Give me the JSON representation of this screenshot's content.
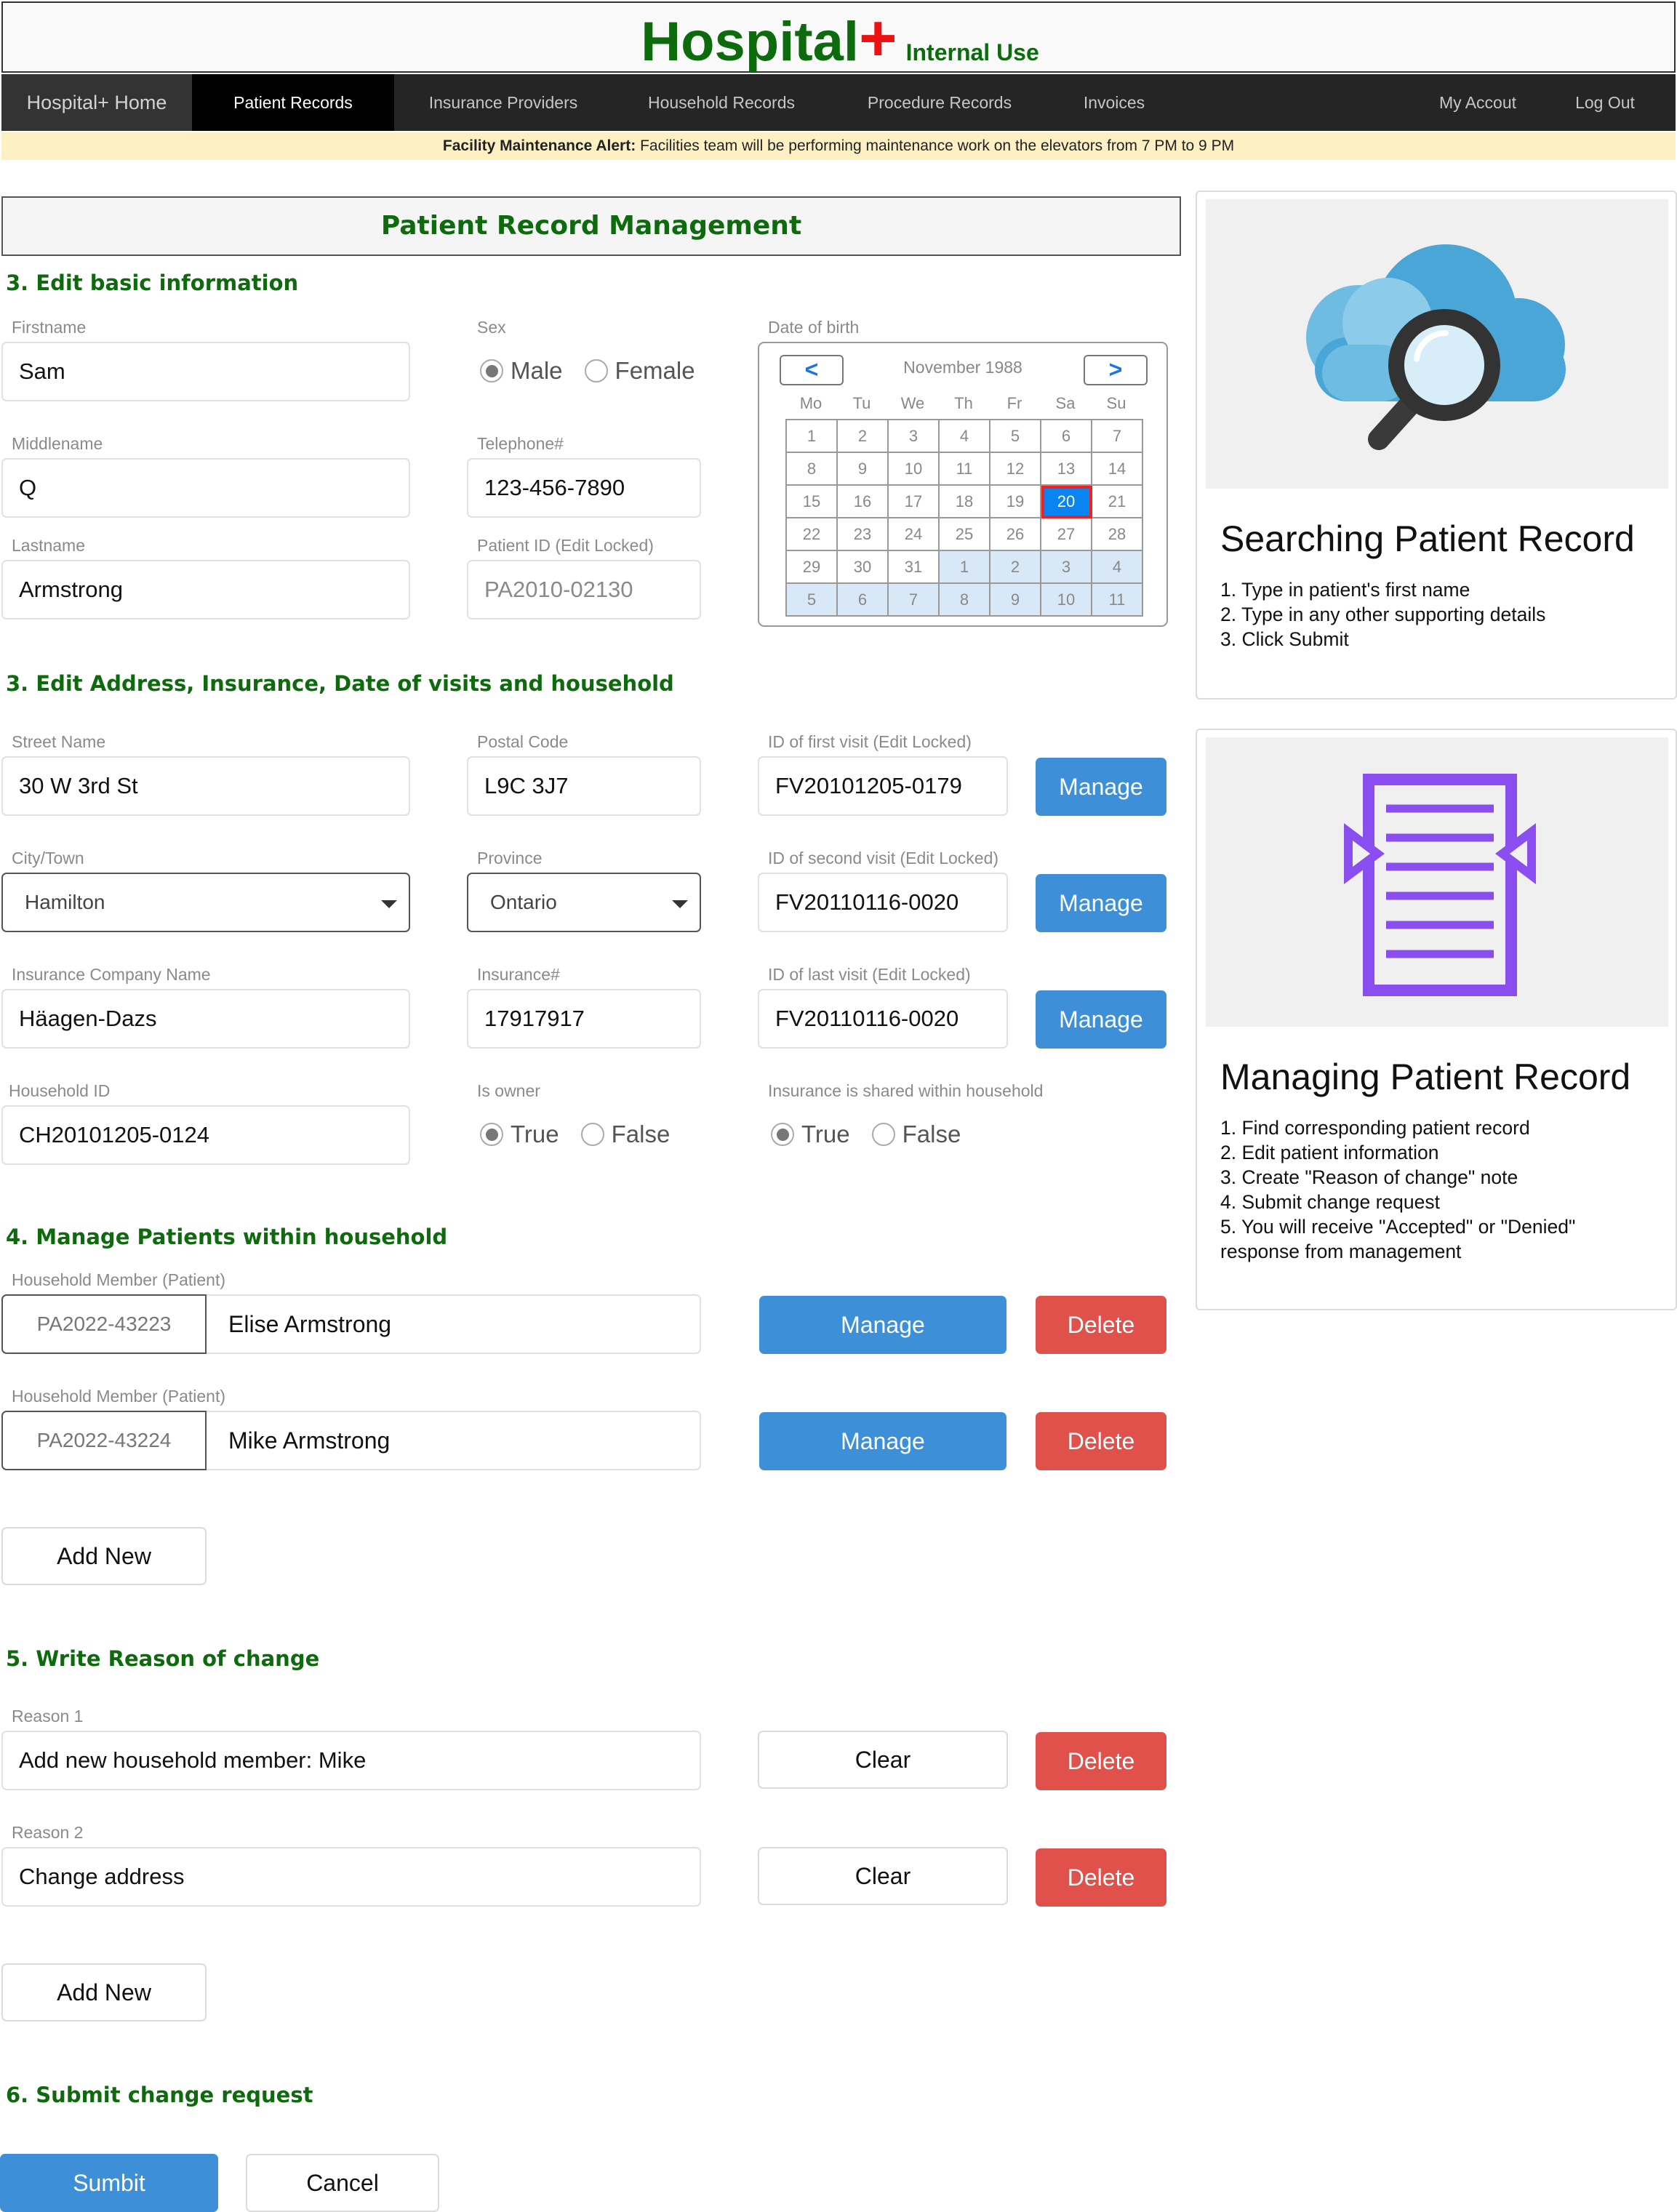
{
  "app": {
    "brand_name": "Hospital",
    "brand_plus": "+",
    "brand_subtitle": "Internal Use"
  },
  "nav": {
    "items": [
      {
        "label": "Hospital+ Home"
      },
      {
        "label": "Patient Records"
      },
      {
        "label": "Insurance Providers"
      },
      {
        "label": "Household Records"
      },
      {
        "label": "Procedure Records"
      },
      {
        "label": "Invoices"
      }
    ],
    "right_items": [
      {
        "label": "My Accout"
      },
      {
        "label": "Log Out"
      }
    ],
    "active": "Patient Records"
  },
  "alert": {
    "title": "Facility Maintenance Alert:",
    "message": "Facilities team will be performing maintenance work on the elevators from 7 PM to 9 PM"
  },
  "page_title": "Patient Record Management",
  "sections": {
    "basic": "3. Edit basic information",
    "address": "3. Edit Address, Insurance, Date of visits and household",
    "household": "4. Manage Patients within household",
    "reason": "5. Write Reason of change",
    "submit": "6. Submit change request"
  },
  "basic": {
    "firstname_label": "Firstname",
    "firstname": "Sam",
    "middlename_label": "Middlename",
    "middlename": "Q",
    "lastname_label": "Lastname",
    "lastname": "Armstrong",
    "sex_label": "Sex",
    "sex_options": [
      "Male",
      "Female"
    ],
    "sex_selected": "Male",
    "telephone_label": "Telephone#",
    "telephone": "123-456-7890",
    "patient_id_label": "Patient ID (Edit Locked)",
    "patient_id": "PA2010-02130",
    "dob_label": "Date of birth"
  },
  "calendar": {
    "prev": "<",
    "next": ">",
    "month_label": "November 1988",
    "weekdays": [
      "Mo",
      "Tu",
      "We",
      "Th",
      "Fr",
      "Sa",
      "Su"
    ],
    "days": [
      "1",
      "2",
      "3",
      "4",
      "5",
      "6",
      "7",
      "8",
      "9",
      "10",
      "11",
      "12",
      "13",
      "14",
      "15",
      "16",
      "17",
      "18",
      "19",
      "20",
      "21",
      "22",
      "23",
      "24",
      "25",
      "26",
      "27",
      "28",
      "29",
      "30",
      "31",
      "1",
      "2",
      "3",
      "4",
      "5",
      "6",
      "7",
      "8",
      "9",
      "10",
      "11"
    ],
    "selected_day": "20",
    "colors": {
      "selected": "#0a84f0",
      "selected_outline": "#ee2222",
      "other_month": "#d8e8f7"
    }
  },
  "address": {
    "street_label": "Street Name",
    "street": "30 W 3rd St",
    "postal_label": "Postal Code",
    "postal": "L9C 3J7",
    "city_label": "City/Town",
    "city": "Hamilton",
    "province_label": "Province",
    "province": "Ontario",
    "insurance_company_label": "Insurance Company Name",
    "insurance_company": "Häagen-Dazs",
    "insurance_no_label": "Insurance#",
    "insurance_no": "17917917",
    "household_id_label": "Household ID",
    "household_id": "CH20101205-0124",
    "is_owner_label": "Is owner",
    "is_owner_options": [
      "True",
      "False"
    ],
    "is_owner_selected": "True",
    "shared_label": "Insurance is shared within household",
    "shared_options": [
      "True",
      "False"
    ],
    "shared_selected": "True",
    "first_visit_label": "ID of first visit (Edit Locked)",
    "first_visit": "FV20101205-0179",
    "second_visit_label": "ID of second visit (Edit Locked)",
    "second_visit": "FV20110116-0020",
    "last_visit_label": "ID of last visit (Edit Locked)",
    "last_visit": "FV20110116-0020",
    "manage_label": "Manage"
  },
  "household": {
    "members": [
      {
        "label": "Household Member (Patient)",
        "id": "PA2022-43223",
        "name": "Elise Armstrong"
      },
      {
        "label": "Household Member (Patient)",
        "id": "PA2022-43224",
        "name": "Mike Armstrong"
      }
    ],
    "manage_label": "Manage",
    "delete_label": "Delete",
    "add_new_label": "Add New"
  },
  "reasons": {
    "items": [
      {
        "label": "Reason 1",
        "value": "Add new household member: Mike"
      },
      {
        "label": "Reason 2",
        "value": "Change address"
      }
    ],
    "clear_label": "Clear",
    "delete_label": "Delete",
    "add_new_label": "Add New"
  },
  "submit": {
    "submit_label": "Sumbit",
    "cancel_label": "Cancel"
  },
  "sidebar": {
    "search_card": {
      "icon": "cloud-search-icon",
      "title": "Searching Patient Record",
      "steps": [
        "1. Type in patient's first name",
        "2. Type in any other supporting details",
        "3. Click Submit"
      ]
    },
    "manage_card": {
      "icon": "document-icon",
      "title": "Managing Patient Record",
      "steps": [
        "1. Find corresponding patient record",
        "2. Edit patient information",
        "3. Create \"Reason of change\" note",
        "4. Submit change request",
        "5. You will receive \"Accepted\" or \"Denied\" response from management"
      ]
    }
  },
  "colors": {
    "brand_green": "#0d6b0d",
    "brand_red": "#ee1111",
    "nav_bg": "#252525",
    "alert_bg": "#fdf0c2",
    "primary_blue": "#3d8fd8",
    "danger_red": "#e0514c"
  }
}
